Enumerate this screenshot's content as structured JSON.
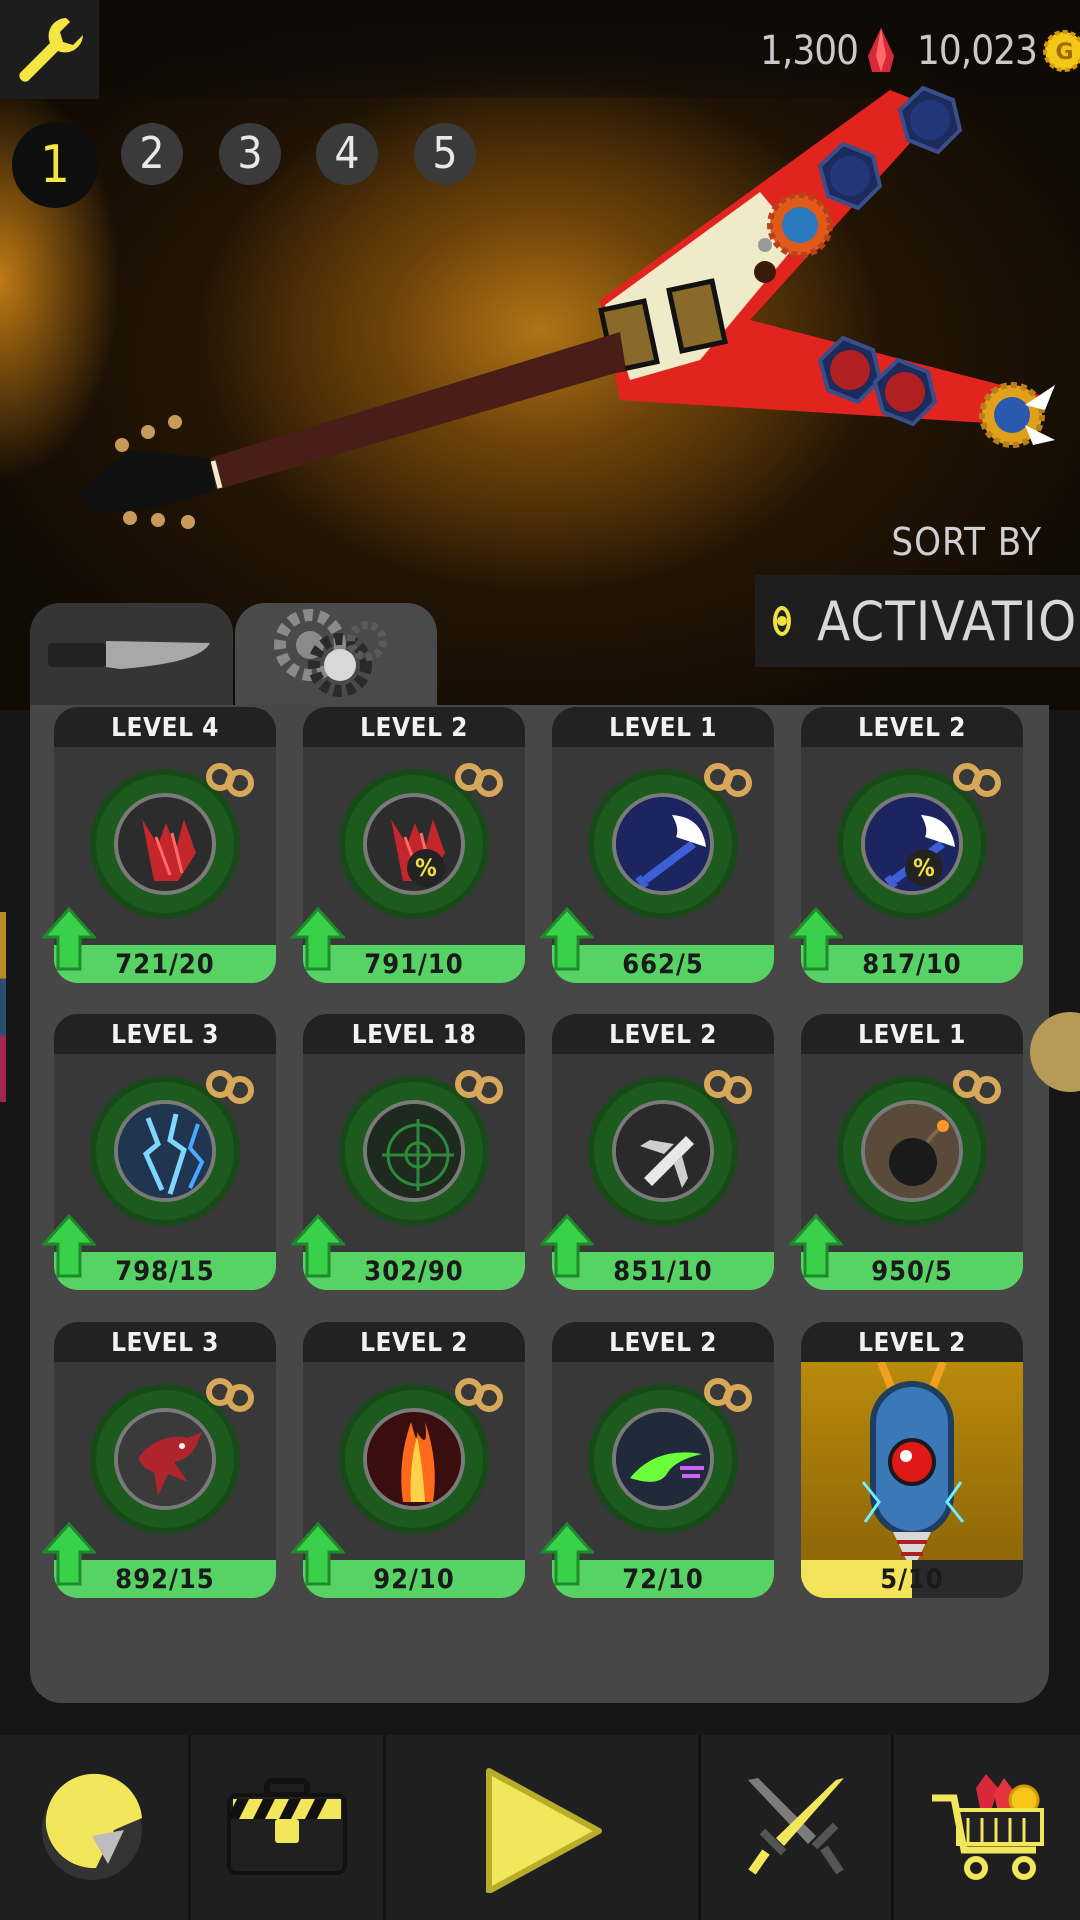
{
  "currencies": {
    "gems": "1,300",
    "gold": "10,023",
    "gold_icon_letter": "G"
  },
  "loadouts": [
    "1",
    "2",
    "3",
    "4",
    "5"
  ],
  "active_loadout": "1",
  "sort": {
    "label": "SORT BY",
    "value": "ACTIVATION"
  },
  "tabs": [
    {
      "name": "weapons-tab",
      "icon": "knife-icon"
    },
    {
      "name": "mods-tab",
      "icon": "gears-icon"
    }
  ],
  "cards": [
    {
      "level": "LEVEL 4",
      "progress": "721/20",
      "icon": "red-claw-icon",
      "percent": false
    },
    {
      "level": "LEVEL 2",
      "progress": "791/10",
      "icon": "red-claw-icon",
      "percent": true
    },
    {
      "level": "LEVEL 1",
      "progress": "662/5",
      "icon": "winged-sword-icon",
      "percent": false
    },
    {
      "level": "LEVEL 2",
      "progress": "817/10",
      "icon": "winged-sword-icon",
      "percent": true
    },
    {
      "level": "LEVEL 3",
      "progress": "798/15",
      "icon": "lightning-icon",
      "percent": false
    },
    {
      "level": "LEVEL 18",
      "progress": "302/90",
      "icon": "crosshair-icon",
      "percent": false
    },
    {
      "level": "LEVEL 2",
      "progress": "851/10",
      "icon": "jet-icon",
      "percent": false
    },
    {
      "level": "LEVEL 1",
      "progress": "950/5",
      "icon": "bomb-icon",
      "percent": false
    },
    {
      "level": "LEVEL 3",
      "progress": "892/15",
      "icon": "dragon-icon",
      "percent": false
    },
    {
      "level": "LEVEL 2",
      "progress": "92/10",
      "icon": "fire-pillar-icon",
      "percent": false
    },
    {
      "level": "LEVEL 2",
      "progress": "72/10",
      "icon": "green-dash-icon",
      "percent": false
    },
    {
      "level": "LEVEL 2",
      "progress": "5/10",
      "icon": "drill-robot-icon",
      "percent": false
    }
  ],
  "percent_symbol": "%",
  "nav": [
    "helmet-icon",
    "toolbox-icon",
    "play-icon",
    "swords-icon",
    "shop-cart-icon"
  ]
}
